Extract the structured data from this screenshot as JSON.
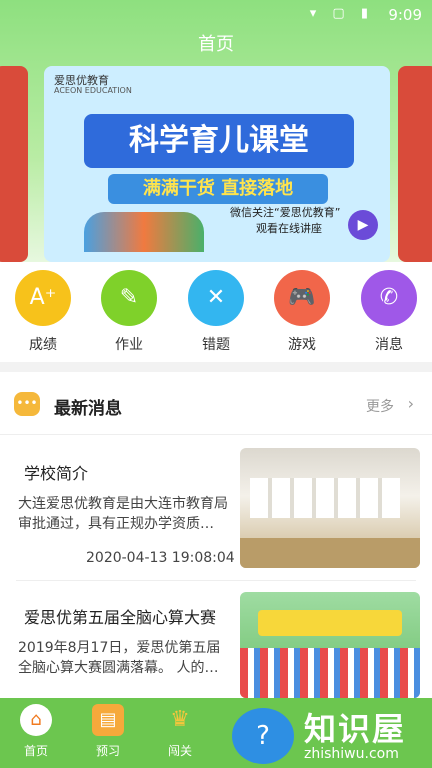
{
  "status": {
    "time": "9:09",
    "icons": "▾ ▢ ▮"
  },
  "header": {
    "title": "首页"
  },
  "banner": {
    "brand": "爱思优教育",
    "brand_en": "ACEON EDUCATION",
    "headline": "科学育儿课堂",
    "subline": "满满干货 直接落地",
    "note1": "微信关注“爱思优教育”",
    "note2": "观看在线讲座"
  },
  "shortcuts": [
    {
      "label": "成绩",
      "icon": "grade-icon",
      "glyph": "A⁺",
      "color": "#f7c21b"
    },
    {
      "label": "作业",
      "icon": "pencil-icon",
      "glyph": "✎",
      "color": "#7fd12a"
    },
    {
      "label": "错题",
      "icon": "wrong-question-icon",
      "glyph": "✕",
      "color": "#33b6f0"
    },
    {
      "label": "游戏",
      "icon": "gamepad-icon",
      "glyph": "🎮",
      "color": "#f1664a"
    },
    {
      "label": "消息",
      "icon": "phone-icon",
      "glyph": "✆",
      "color": "#9f58e8"
    }
  ],
  "news": {
    "title": "最新消息",
    "more": "更多",
    "items": [
      {
        "title": "学校简介",
        "desc": "大连爱思优教育是由大连市教育局审批通过，具有正规办学资质…",
        "time": "2020-04-13 19:08:04"
      },
      {
        "title": "爱思优第五届全脑心算大赛",
        "desc": "2019年8月17日，爱思优第五届全脑心算大赛圆满落幕。 人的…",
        "time": ""
      }
    ]
  },
  "tabbar": {
    "items": [
      {
        "label": "首页",
        "icon": "home-icon"
      },
      {
        "label": "预习",
        "icon": "book-icon"
      },
      {
        "label": "闯关",
        "icon": "trophy-icon"
      }
    ]
  },
  "watermark": {
    "text": "知识屋",
    "domain": "zhishiwu.com"
  }
}
